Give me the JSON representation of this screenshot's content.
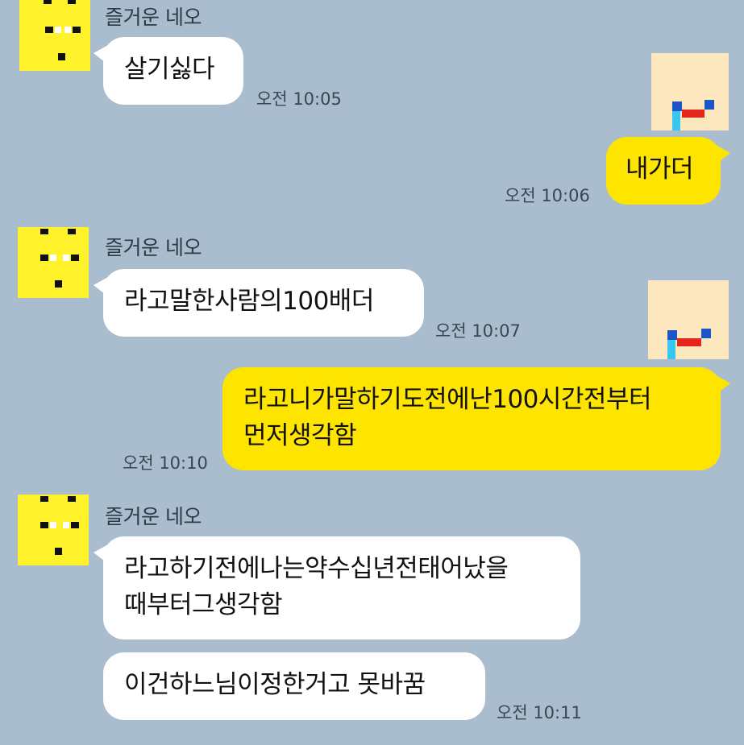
{
  "chat": {
    "contact_name": "즐거운 네오",
    "messages": [
      {
        "text": "살기싫다",
        "time": "오전 10:05",
        "sender": "other"
      },
      {
        "text": "내가더",
        "time": "오전 10:06",
        "sender": "me"
      },
      {
        "text": "라고말한사람의100배더",
        "time": "오전 10:07",
        "sender": "other"
      },
      {
        "text_line1": "라고니가말하기도전에난100시간전부터",
        "text_line2": "먼저생각함",
        "time": "오전 10:10",
        "sender": "me"
      },
      {
        "text_line1": "라고하기전에나는약수십년전태어났을",
        "text_line2": "때부터그생각함",
        "sender": "other"
      },
      {
        "text": "이건하느님이정한거고 못바꿈",
        "time": "오전 10:11",
        "sender": "other"
      }
    ]
  },
  "colors": {
    "background": "#a9bdcf",
    "incoming_bubble": "#ffffff",
    "outgoing_bubble": "#fee500",
    "neo_avatar": "#fff22a",
    "my_avatar": "#fde7bf"
  }
}
